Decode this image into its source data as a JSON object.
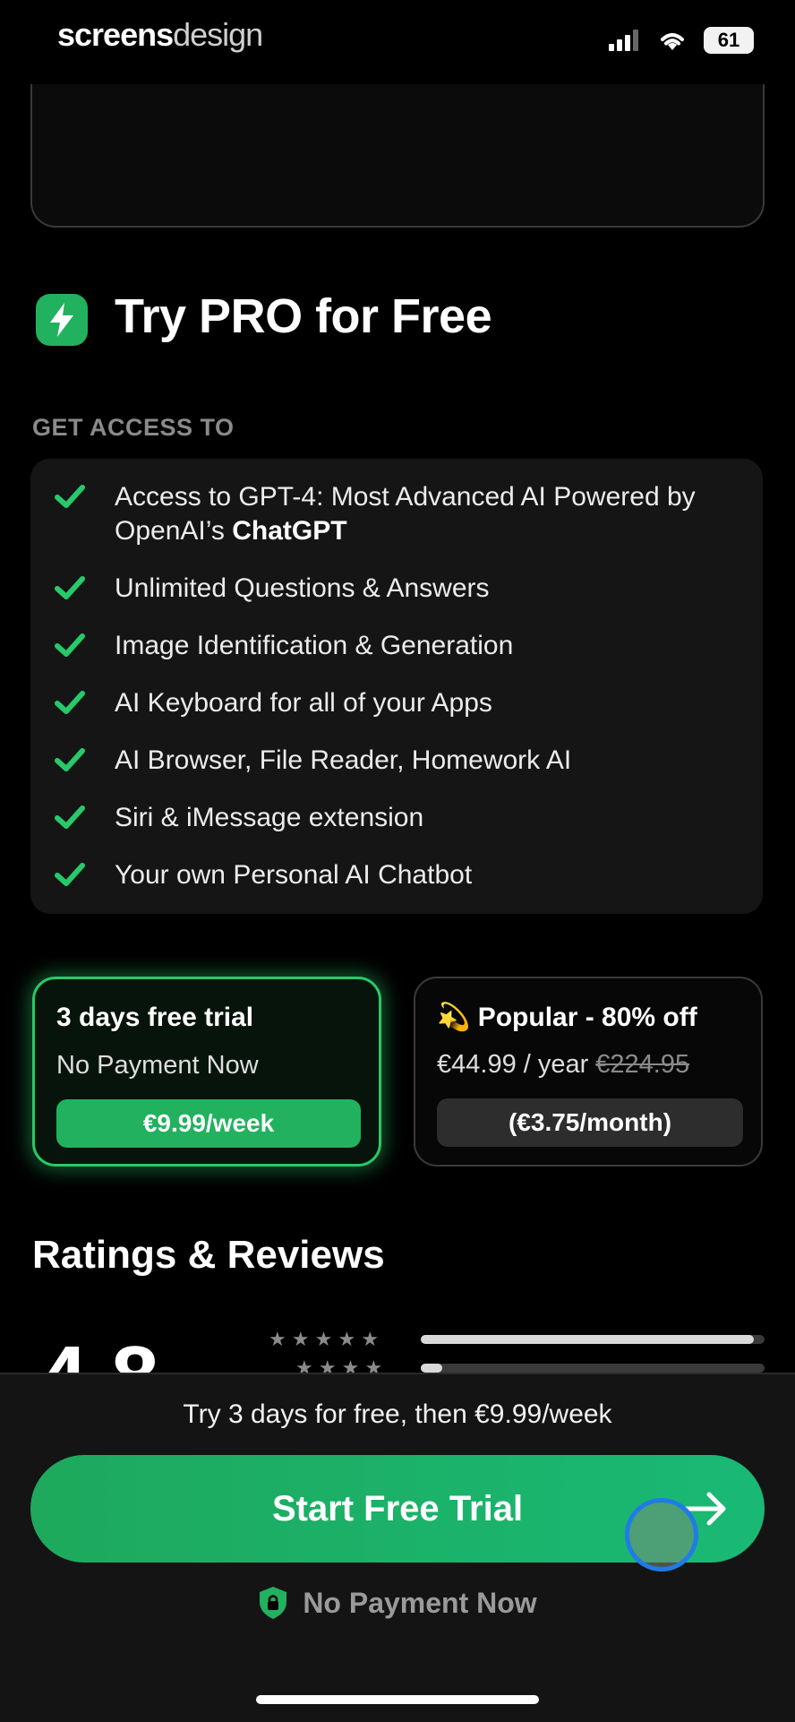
{
  "status_bar": {
    "brand_part1": "screens",
    "brand_part2": "design",
    "battery": "61"
  },
  "hero": {
    "title": "Try PRO for Free",
    "icon": "lightning-icon"
  },
  "section_label": "GET ACCESS TO",
  "features": [
    {
      "text": "Access to GPT-4: Most Advanced AI Powered by OpenAI’s ",
      "bold": "ChatGPT"
    },
    {
      "text": "Unlimited Questions & Answers",
      "bold": ""
    },
    {
      "text": "Image Identification & Generation",
      "bold": ""
    },
    {
      "text": "AI Keyboard for all of your Apps",
      "bold": ""
    },
    {
      "text": "AI Browser, File Reader, Homework AI",
      "bold": ""
    },
    {
      "text": "Siri & iMessage extension",
      "bold": ""
    },
    {
      "text": "Your own Personal AI Chatbot",
      "bold": ""
    }
  ],
  "plans": {
    "trial": {
      "title": "3 days free trial",
      "subtitle": "No Payment Now",
      "price": "€9.99/week",
      "selected": true
    },
    "popular": {
      "emoji": "💫",
      "title": "Popular - 80% off",
      "price": "€44.99 / year",
      "old_price": "€224.95",
      "monthly": "(€3.75/month)"
    }
  },
  "ratings": {
    "title": "Ratings & Reviews",
    "score": "4.8",
    "bars": [
      {
        "stars": 5,
        "fraction": 0.97
      },
      {
        "stars": 4,
        "fraction": 0.05
      }
    ]
  },
  "bottom": {
    "trial_text": "Try 3 days for free, then €9.99/week",
    "cta_label": "Start Free Trial",
    "no_payment": "No Payment Now"
  },
  "colors": {
    "accent": "#22b15e",
    "background": "#000000",
    "tap_ring": "#1f7be8"
  }
}
